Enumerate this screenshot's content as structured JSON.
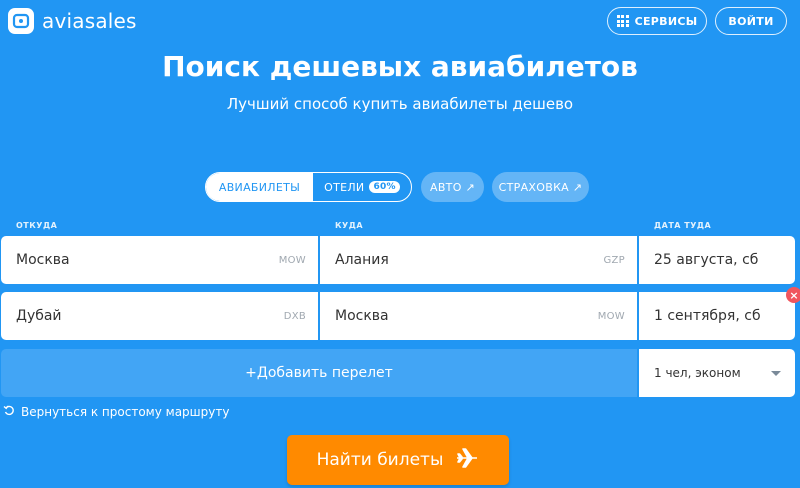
{
  "header": {
    "logo_text": "aviasales",
    "services_label": "СЕРВИСЫ",
    "login_label": "ВОЙТИ"
  },
  "hero": {
    "title": "Поиск дешевых авиабилетов",
    "subtitle": "Лучший способ купить авиабилеты дешево"
  },
  "tabs": {
    "flights": "АВИАБИЛЕТЫ",
    "hotels": "ОТЕЛИ",
    "hotels_badge": "60%",
    "auto": "АВТО ↗",
    "insurance": "СТРАХОВКА ↗"
  },
  "labels": {
    "from": "ОТКУДА",
    "to": "КУДА",
    "date": "ДАТА ТУДА"
  },
  "segments": [
    {
      "from": "Москва",
      "from_code": "MOW",
      "to": "Алания",
      "to_code": "GZP",
      "date": "25 августа, сб"
    },
    {
      "from": "Дубай",
      "from_code": "DXB",
      "to": "Москва",
      "to_code": "MOW",
      "date": "1 сентября, сб"
    }
  ],
  "add_flight_label": "+Добавить перелет",
  "passengers": "1 чел, эконом",
  "back_link": "Вернуться к простому маршруту",
  "search_button": "Найти билеты",
  "colors": {
    "background": "#2196f3",
    "accent_button": "#ff8a00",
    "remove": "#f0565e"
  },
  "icons": [
    "logo-icon",
    "grid-icon",
    "close-icon",
    "chevron-down-icon",
    "undo-icon",
    "airplane-icon"
  ]
}
